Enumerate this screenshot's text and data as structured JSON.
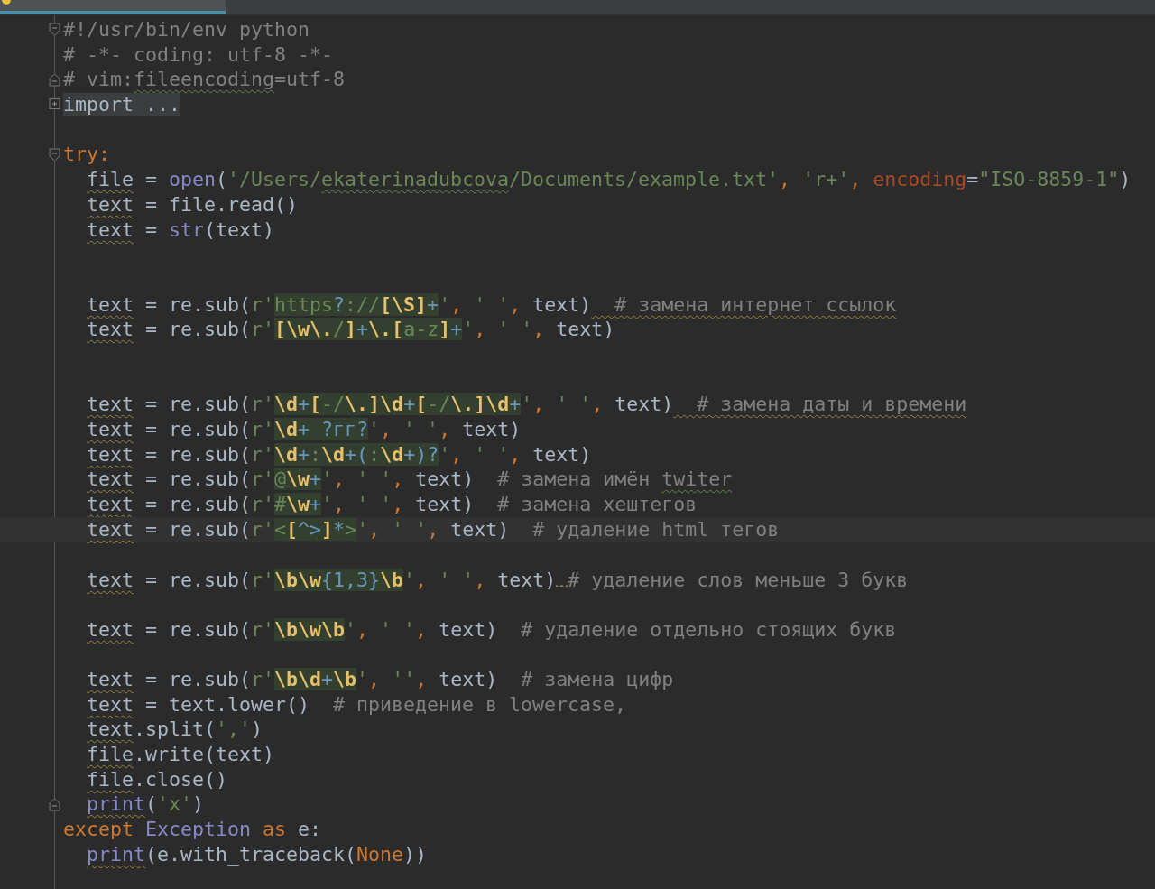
{
  "editor": {
    "lines": [
      {
        "kind": "code",
        "fold_start": true,
        "current": false,
        "tokens": [
          {
            "text": "#!/usr/bin/env python",
            "kind": "comment"
          }
        ]
      },
      {
        "kind": "code",
        "current": false,
        "tokens": [
          {
            "text": "# -*- coding: utf-8 -*-",
            "kind": "comment"
          }
        ]
      },
      {
        "kind": "code",
        "fold_end": true,
        "current": false,
        "tokens": [
          {
            "text": "# vim:",
            "kind": "comment"
          },
          {
            "text": "fileencoding",
            "kind": "comment",
            "typo": true
          },
          {
            "text": "=utf-8",
            "kind": "comment"
          }
        ]
      },
      {
        "kind": "code",
        "collapsed": true,
        "current": false,
        "tokens": [
          {
            "text": "import ...",
            "kind": "folded"
          }
        ]
      },
      {
        "kind": "blank",
        "current": false
      },
      {
        "kind": "code",
        "fold_start": true,
        "current": false,
        "tokens": [
          {
            "text": "try:",
            "kind": "keyword"
          }
        ]
      },
      {
        "kind": "code",
        "indented": true,
        "current": false,
        "tokens": [
          {
            "text": "file",
            "kind": "plain",
            "warning": true
          },
          {
            "text": " = ",
            "kind": "plain"
          },
          {
            "text": "open",
            "kind": "builtin"
          },
          {
            "text": "(",
            "kind": "plain"
          },
          {
            "text": "'/Users/",
            "kind": "string"
          },
          {
            "text": "ekaterinadubcova",
            "kind": "string",
            "typo": true
          },
          {
            "text": "/Documents/example.txt'",
            "kind": "string"
          },
          {
            "text": ", ",
            "kind": "keyword"
          },
          {
            "text": "'r+'",
            "kind": "string"
          },
          {
            "text": ", ",
            "kind": "keyword"
          },
          {
            "text": "encoding",
            "kind": "param"
          },
          {
            "text": "=",
            "kind": "plain"
          },
          {
            "text": "\"ISO-8859-1\"",
            "kind": "string"
          },
          {
            "text": ")",
            "kind": "plain"
          }
        ]
      },
      {
        "kind": "code",
        "indented": true,
        "current": false,
        "tokens": [
          {
            "text": "text",
            "kind": "plain",
            "warning": true
          },
          {
            "text": " = file.read()",
            "kind": "plain"
          }
        ]
      },
      {
        "kind": "code",
        "indented": true,
        "current": false,
        "tokens": [
          {
            "text": "text",
            "kind": "plain",
            "warning": true
          },
          {
            "text": " = ",
            "kind": "plain"
          },
          {
            "text": "str",
            "kind": "builtin"
          },
          {
            "text": "(text)",
            "kind": "plain"
          }
        ]
      },
      {
        "kind": "blank",
        "current": false
      },
      {
        "kind": "blank",
        "current": false
      },
      {
        "kind": "code",
        "indented": true,
        "current": false,
        "tokens": [
          {
            "text": "text",
            "kind": "plain",
            "warning": true
          },
          {
            "text": " = re.sub(",
            "kind": "plain"
          },
          {
            "text": "r'",
            "kind": "string"
          },
          {
            "text": "https",
            "kind": "regex"
          },
          {
            "text": "?",
            "kind": "meta"
          },
          {
            "text": "://",
            "kind": "regex"
          },
          {
            "text": "[\\S]",
            "kind": "escape"
          },
          {
            "text": "+",
            "kind": "meta"
          },
          {
            "text": "'",
            "kind": "string"
          },
          {
            "text": ", ",
            "kind": "keyword"
          },
          {
            "text": "' '",
            "kind": "string"
          },
          {
            "text": ", ",
            "kind": "keyword"
          },
          {
            "text": "text)",
            "kind": "plain"
          },
          {
            "text": "  # замена интернет ссылок",
            "kind": "comment",
            "warning": true
          }
        ]
      },
      {
        "kind": "code",
        "indented": true,
        "current": false,
        "tokens": [
          {
            "text": "text",
            "kind": "plain",
            "warning": true
          },
          {
            "text": " = re.sub(",
            "kind": "plain"
          },
          {
            "text": "r'",
            "kind": "string"
          },
          {
            "text": "[\\w\\.",
            "kind": "escape"
          },
          {
            "text": "/",
            "kind": "regex"
          },
          {
            "text": "]",
            "kind": "escape"
          },
          {
            "text": "+",
            "kind": "meta"
          },
          {
            "text": "\\.[",
            "kind": "escape"
          },
          {
            "text": "a-z",
            "kind": "regex"
          },
          {
            "text": "]",
            "kind": "escape"
          },
          {
            "text": "+",
            "kind": "meta"
          },
          {
            "text": "'",
            "kind": "string"
          },
          {
            "text": ", ",
            "kind": "keyword"
          },
          {
            "text": "' '",
            "kind": "string"
          },
          {
            "text": ", ",
            "kind": "keyword"
          },
          {
            "text": "text)",
            "kind": "plain"
          }
        ]
      },
      {
        "kind": "blank",
        "current": false
      },
      {
        "kind": "blank",
        "current": false
      },
      {
        "kind": "code",
        "indented": true,
        "current": false,
        "tokens": [
          {
            "text": "text",
            "kind": "plain",
            "warning": true
          },
          {
            "text": " = re.sub(",
            "kind": "plain"
          },
          {
            "text": "r'",
            "kind": "string"
          },
          {
            "text": "\\d",
            "kind": "escape"
          },
          {
            "text": "+",
            "kind": "meta"
          },
          {
            "text": "[",
            "kind": "escape"
          },
          {
            "text": "-/",
            "kind": "regex"
          },
          {
            "text": "\\.]\\d",
            "kind": "escape"
          },
          {
            "text": "+",
            "kind": "meta"
          },
          {
            "text": "[",
            "kind": "escape"
          },
          {
            "text": "-/",
            "kind": "regex"
          },
          {
            "text": "\\.]\\d",
            "kind": "escape"
          },
          {
            "text": "+",
            "kind": "meta"
          },
          {
            "text": "'",
            "kind": "string"
          },
          {
            "text": ", ",
            "kind": "keyword"
          },
          {
            "text": "' '",
            "kind": "string"
          },
          {
            "text": ", ",
            "kind": "keyword"
          },
          {
            "text": "text)",
            "kind": "plain"
          },
          {
            "text": "  # замена даты и времени",
            "kind": "comment",
            "warning": true
          }
        ]
      },
      {
        "kind": "code",
        "indented": true,
        "current": false,
        "tokens": [
          {
            "text": "text",
            "kind": "plain",
            "warning": true
          },
          {
            "text": " = re.sub(",
            "kind": "plain"
          },
          {
            "text": "r'",
            "kind": "string"
          },
          {
            "text": "\\d",
            "kind": "escape"
          },
          {
            "text": "+ ?гг?",
            "kind": "meta"
          },
          {
            "text": "'",
            "kind": "string"
          },
          {
            "text": ", ",
            "kind": "keyword"
          },
          {
            "text": "' '",
            "kind": "string"
          },
          {
            "text": ", ",
            "kind": "keyword"
          },
          {
            "text": "text)",
            "kind": "plain"
          }
        ]
      },
      {
        "kind": "code",
        "indented": true,
        "current": false,
        "tokens": [
          {
            "text": "text",
            "kind": "plain",
            "warning": true
          },
          {
            "text": " = re.sub(",
            "kind": "plain"
          },
          {
            "text": "r'",
            "kind": "string"
          },
          {
            "text": "\\d",
            "kind": "escape"
          },
          {
            "text": "+",
            "kind": "meta"
          },
          {
            "text": ":",
            "kind": "regex"
          },
          {
            "text": "\\d",
            "kind": "escape"
          },
          {
            "text": "+(",
            "kind": "meta"
          },
          {
            "text": ":",
            "kind": "regex"
          },
          {
            "text": "\\d",
            "kind": "escape"
          },
          {
            "text": "+)?",
            "kind": "meta"
          },
          {
            "text": "'",
            "kind": "string"
          },
          {
            "text": ", ",
            "kind": "keyword"
          },
          {
            "text": "' '",
            "kind": "string"
          },
          {
            "text": ", ",
            "kind": "keyword"
          },
          {
            "text": "text)",
            "kind": "plain"
          }
        ]
      },
      {
        "kind": "code",
        "indented": true,
        "current": false,
        "tokens": [
          {
            "text": "text",
            "kind": "plain",
            "warning": true
          },
          {
            "text": " = re.sub(",
            "kind": "plain"
          },
          {
            "text": "r'",
            "kind": "string"
          },
          {
            "text": "@",
            "kind": "regex"
          },
          {
            "text": "\\w",
            "kind": "escape"
          },
          {
            "text": "+",
            "kind": "meta"
          },
          {
            "text": "'",
            "kind": "string"
          },
          {
            "text": ", ",
            "kind": "keyword"
          },
          {
            "text": "' '",
            "kind": "string"
          },
          {
            "text": ", ",
            "kind": "keyword"
          },
          {
            "text": "text)",
            "kind": "plain"
          },
          {
            "text": "  # замена имён ",
            "kind": "comment"
          },
          {
            "text": "twiter",
            "kind": "comment",
            "typo": true
          }
        ]
      },
      {
        "kind": "code",
        "indented": true,
        "current": false,
        "tokens": [
          {
            "text": "text",
            "kind": "plain",
            "warning": true
          },
          {
            "text": " = re.sub(",
            "kind": "plain"
          },
          {
            "text": "r'",
            "kind": "string"
          },
          {
            "text": "#",
            "kind": "regex"
          },
          {
            "text": "\\w",
            "kind": "escape"
          },
          {
            "text": "+",
            "kind": "meta"
          },
          {
            "text": "'",
            "kind": "string"
          },
          {
            "text": ", ",
            "kind": "keyword"
          },
          {
            "text": "' '",
            "kind": "string"
          },
          {
            "text": ", ",
            "kind": "keyword"
          },
          {
            "text": "text)",
            "kind": "plain"
          },
          {
            "text": "  # замена хештегов",
            "kind": "comment"
          }
        ]
      },
      {
        "kind": "code",
        "indented": true,
        "current": true,
        "tokens": [
          {
            "text": "text",
            "kind": "plain",
            "warning": true
          },
          {
            "text": " = re.sub(",
            "kind": "plain"
          },
          {
            "text": "r'",
            "kind": "string"
          },
          {
            "text": "<",
            "kind": "regex"
          },
          {
            "text": "[",
            "kind": "escape"
          },
          {
            "text": "^>",
            "kind": "meta"
          },
          {
            "text": "]",
            "kind": "escape"
          },
          {
            "text": "*",
            "kind": "meta"
          },
          {
            "text": ">",
            "kind": "regex"
          },
          {
            "text": "'",
            "kind": "string"
          },
          {
            "text": ", ",
            "kind": "keyword"
          },
          {
            "text": "' '",
            "kind": "string"
          },
          {
            "text": ", ",
            "kind": "keyword"
          },
          {
            "text": "text)",
            "kind": "plain"
          },
          {
            "text": "  # удаление html тегов",
            "kind": "comment"
          }
        ]
      },
      {
        "kind": "blank",
        "current": false
      },
      {
        "kind": "code",
        "indented": true,
        "current": false,
        "tokens": [
          {
            "text": "text",
            "kind": "plain",
            "warning": true
          },
          {
            "text": " = re.sub(",
            "kind": "plain"
          },
          {
            "text": "r'",
            "kind": "string"
          },
          {
            "text": "\\b\\w",
            "kind": "escape"
          },
          {
            "text": "{1,3}",
            "kind": "meta"
          },
          {
            "text": "\\b",
            "kind": "escape"
          },
          {
            "text": "'",
            "kind": "string"
          },
          {
            "text": ", ",
            "kind": "keyword"
          },
          {
            "text": "' '",
            "kind": "string"
          },
          {
            "text": ", ",
            "kind": "keyword"
          },
          {
            "text": "text)",
            "kind": "plain"
          },
          {
            "text": "# удаление слов меньше 3 букв",
            "kind": "comment",
            "gap_warning": true
          }
        ]
      },
      {
        "kind": "blank",
        "current": false
      },
      {
        "kind": "code",
        "indented": true,
        "current": false,
        "tokens": [
          {
            "text": "text",
            "kind": "plain",
            "warning": true
          },
          {
            "text": " = re.sub(",
            "kind": "plain"
          },
          {
            "text": "r'",
            "kind": "string"
          },
          {
            "text": "\\b\\w\\b",
            "kind": "escape"
          },
          {
            "text": "'",
            "kind": "string"
          },
          {
            "text": ", ",
            "kind": "keyword"
          },
          {
            "text": "' '",
            "kind": "string"
          },
          {
            "text": ", ",
            "kind": "keyword"
          },
          {
            "text": "text)",
            "kind": "plain"
          },
          {
            "text": "  # удаление отдельно стоящих букв",
            "kind": "comment"
          }
        ]
      },
      {
        "kind": "blank",
        "current": false
      },
      {
        "kind": "code",
        "indented": true,
        "current": false,
        "tokens": [
          {
            "text": "text",
            "kind": "plain",
            "warning": true
          },
          {
            "text": " = re.sub(",
            "kind": "plain"
          },
          {
            "text": "r'",
            "kind": "string"
          },
          {
            "text": "\\b\\d",
            "kind": "escape"
          },
          {
            "text": "+",
            "kind": "meta"
          },
          {
            "text": "\\b",
            "kind": "escape"
          },
          {
            "text": "'",
            "kind": "string"
          },
          {
            "text": ", ",
            "kind": "keyword"
          },
          {
            "text": "''",
            "kind": "string"
          },
          {
            "text": ", ",
            "kind": "keyword"
          },
          {
            "text": "text)",
            "kind": "plain"
          },
          {
            "text": "  # замена цифр",
            "kind": "comment"
          }
        ]
      },
      {
        "kind": "code",
        "indented": true,
        "current": false,
        "tokens": [
          {
            "text": "text",
            "kind": "plain",
            "warning": true
          },
          {
            "text": " = text.lower()",
            "kind": "plain"
          },
          {
            "text": "  # приведение в lowercase,",
            "kind": "comment"
          }
        ]
      },
      {
        "kind": "code",
        "indented": true,
        "current": false,
        "tokens": [
          {
            "text": "text",
            "kind": "plain",
            "warning": true
          },
          {
            "text": ".split(",
            "kind": "plain"
          },
          {
            "text": "','",
            "kind": "string"
          },
          {
            "text": ")",
            "kind": "plain"
          }
        ]
      },
      {
        "kind": "code",
        "indented": true,
        "current": false,
        "tokens": [
          {
            "text": "file",
            "kind": "plain",
            "warning": true
          },
          {
            "text": ".write(text)",
            "kind": "plain"
          }
        ]
      },
      {
        "kind": "code",
        "indented": true,
        "current": false,
        "tokens": [
          {
            "text": "file",
            "kind": "plain",
            "warning": true
          },
          {
            "text": ".close()",
            "kind": "plain"
          }
        ]
      },
      {
        "kind": "code",
        "indented": true,
        "fold_end": true,
        "current": false,
        "tokens": [
          {
            "text": "print",
            "kind": "builtin",
            "warning": true
          },
          {
            "text": "(",
            "kind": "plain"
          },
          {
            "text": "'x'",
            "kind": "string"
          },
          {
            "text": ")",
            "kind": "plain"
          }
        ]
      },
      {
        "kind": "code",
        "current": false,
        "tokens": [
          {
            "text": "except ",
            "kind": "keyword"
          },
          {
            "text": "Exception",
            "kind": "builtin"
          },
          {
            "text": " as ",
            "kind": "keyword"
          },
          {
            "text": "e:",
            "kind": "plain"
          }
        ]
      },
      {
        "kind": "code",
        "indented": true,
        "current": false,
        "tokens": [
          {
            "text": "print",
            "kind": "builtin",
            "warning": true
          },
          {
            "text": "(e.with_traceback(",
            "kind": "plain"
          },
          {
            "text": "None",
            "kind": "keyword"
          },
          {
            "text": "))",
            "kind": "plain"
          }
        ]
      }
    ]
  }
}
